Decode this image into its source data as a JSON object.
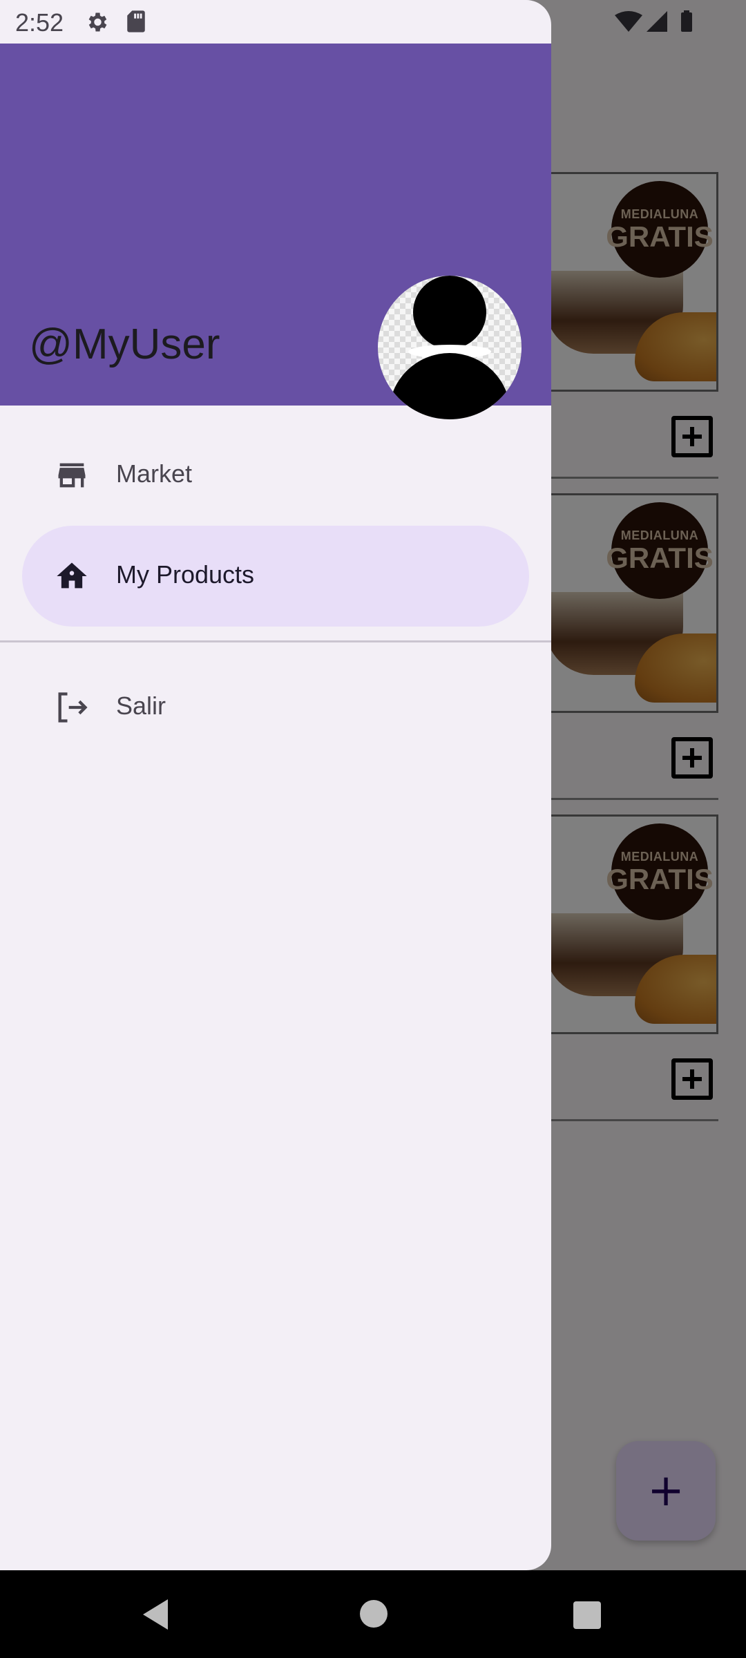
{
  "status_bar": {
    "time": "2:52",
    "icons": [
      "settings-icon",
      "sd-card-icon",
      "wifi-icon",
      "signal-icon",
      "battery-icon"
    ]
  },
  "drawer": {
    "header": {
      "username": "@MyUser",
      "background_color": "#6750a4"
    },
    "items": [
      {
        "label": "Market",
        "icon": "store-icon",
        "active": false
      },
      {
        "label": "My Products",
        "icon": "home-icon",
        "active": true
      },
      {
        "label": "Salir",
        "icon": "logout-icon",
        "active": false
      }
    ]
  },
  "background_list": {
    "cards": [
      {
        "badge_top": "MEDIALUNA",
        "badge_main": "GRATIS"
      },
      {
        "badge_top": "MEDIALUNA",
        "badge_main": "GRATIS"
      },
      {
        "badge_top": "MEDIALUNA",
        "badge_main": "GRATIS"
      }
    ],
    "fab_label": "+"
  },
  "colors": {
    "primary": "#6750a4",
    "drawer_bg": "#f3eff6",
    "active_indicator": "#e8def8",
    "fab_bg": "#eaddff"
  }
}
